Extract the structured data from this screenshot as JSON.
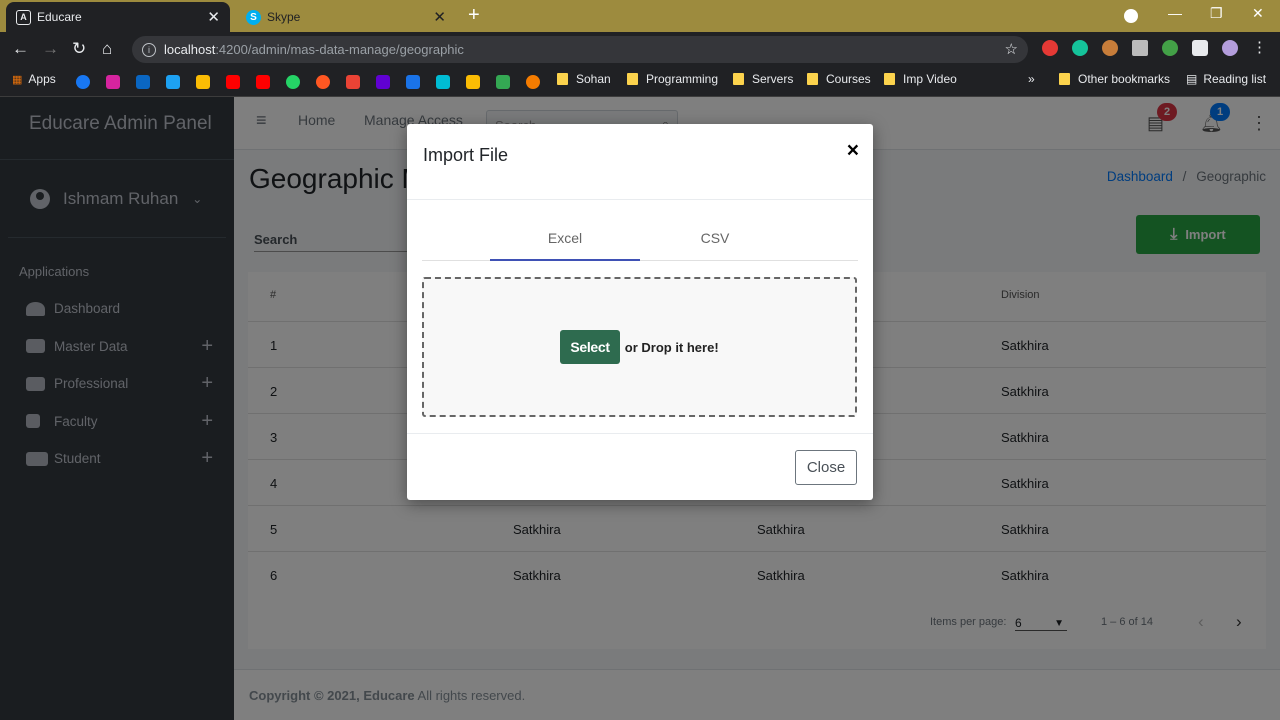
{
  "browser": {
    "tabs": [
      {
        "title": "Educare",
        "favicon": "A"
      },
      {
        "title": "Skype",
        "favicon": "S"
      }
    ],
    "url_host": "localhost",
    "url_path": ":4200/admin/mas-data-manage/geographic",
    "bookmarks": [
      "Apps",
      "Sohan",
      "Programming",
      "Servers",
      "Courses",
      "Imp Video",
      "»",
      "Other bookmarks",
      "Reading list"
    ]
  },
  "sidebar": {
    "brand": "Educare Admin Panel",
    "user": "Ishmam Ruhan",
    "section": "Applications",
    "items": [
      {
        "label": "Dashboard",
        "expandable": ""
      },
      {
        "label": "Master Data",
        "expandable": "+"
      },
      {
        "label": "Professional",
        "expandable": "+"
      },
      {
        "label": "Faculty",
        "expandable": "+"
      },
      {
        "label": "Student",
        "expandable": "+"
      }
    ]
  },
  "topnav": {
    "home": "Home",
    "manage_access": "Manage Access",
    "search_placeholder": "Search",
    "notes_badge": "2",
    "bell_badge": "1"
  },
  "page": {
    "title": "Geographic M",
    "breadcrumb_dashboard": "Dashboard",
    "breadcrumb_sep": "/",
    "breadcrumb_current": "Geographic",
    "search_label": "Search",
    "import_label": "Import"
  },
  "table": {
    "headers": [
      "#",
      "",
      "",
      "Division"
    ],
    "rows": [
      [
        "1",
        "",
        "",
        "Satkhira"
      ],
      [
        "2",
        "",
        "",
        "Satkhira"
      ],
      [
        "3",
        "",
        "",
        "Satkhira"
      ],
      [
        "4",
        "",
        "",
        "Satkhira"
      ],
      [
        "5",
        "Satkhira",
        "Satkhira",
        "Satkhira"
      ],
      [
        "6",
        "Satkhira",
        "Satkhira",
        "Satkhira"
      ]
    ]
  },
  "paginator": {
    "items_per_page_label": "Items per page:",
    "items_per_page": "6",
    "range": "1 – 6 of 14"
  },
  "footer": {
    "copyright": "Copyright © 2021, Educare",
    "rights": "All rights reserved."
  },
  "modal": {
    "title": "Import File",
    "close_x": "×",
    "tabs": [
      "Excel",
      "CSV"
    ],
    "select_label": "Select",
    "drop_text": "or Drop it here!",
    "close_label": "Close"
  },
  "colors": {
    "sidebar_bg": "#343a40",
    "import_green": "#28a745",
    "select_green": "#2e6b4f",
    "tab_indicator": "#3f51b5",
    "link_blue": "#007bff"
  }
}
